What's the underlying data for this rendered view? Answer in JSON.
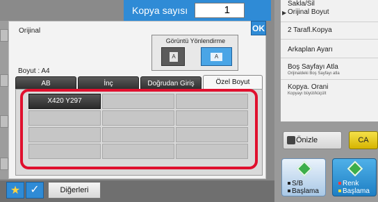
{
  "top_bar": {
    "copies_label": "Kopya sayısı",
    "copies_value": "1"
  },
  "menu": {
    "items": [
      {
        "label": "Sakla/Sil",
        "sub": ""
      },
      {
        "label": "Orijinal Boyut",
        "sub": ""
      },
      {
        "label": "2 Tarafl.Kopya",
        "sub": ""
      },
      {
        "label": "Arkaplan Ayarı",
        "sub": ""
      },
      {
        "label": "Boş Sayfayı Atla",
        "sub": "Orijinaldeki Boş Sayfayı atla"
      },
      {
        "label": "Kopya. Orani",
        "sub": "Kopyayı büyüt/küçült"
      }
    ]
  },
  "preview_button": "Önizle",
  "ca_button": "CA",
  "start_bw": {
    "line1": "S/B",
    "line2": "Başlama"
  },
  "start_color": {
    "line1": "Renk",
    "line2": "Başlama"
  },
  "dialog": {
    "title": "Orijinal",
    "ok_label": "OK",
    "size_info": "Boyut : A4",
    "orientation": {
      "title": "Görüntü Yönlendirme",
      "option_a": "A",
      "option_b": "A"
    },
    "tabs": [
      "AB",
      "İnç",
      "Doğrudan Giriş",
      "Özel Boyut"
    ],
    "active_tab": "Özel Boyut",
    "custom_sizes": [
      "X420 Y297"
    ]
  },
  "bottom": {
    "star": "★",
    "check": "✓",
    "others_label": "Diğerleri"
  },
  "colors": {
    "accent": "#2f8bd6",
    "highlight_frame": "#e0102e",
    "start_green": "#3cae4a"
  }
}
